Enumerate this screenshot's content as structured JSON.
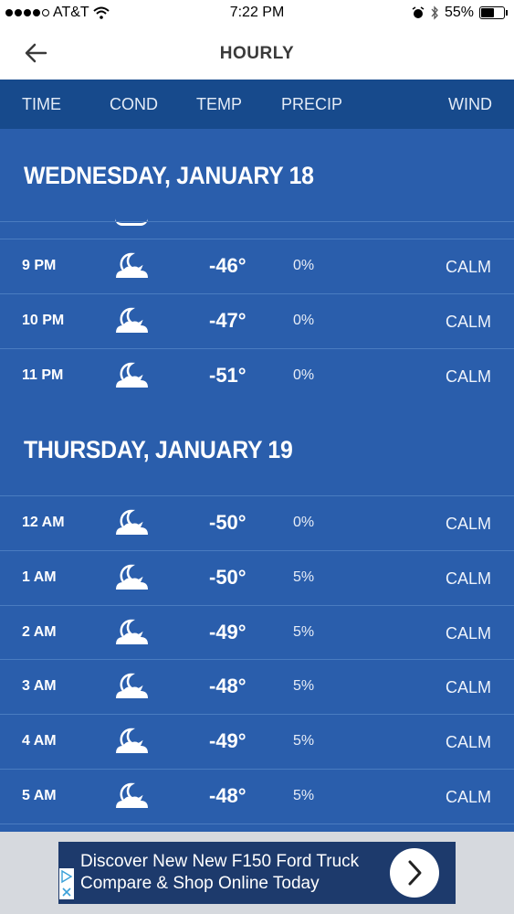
{
  "status_bar": {
    "carrier": "AT&T",
    "time": "7:22 PM",
    "battery": "55%"
  },
  "header": {
    "title": "HOURLY"
  },
  "columns": {
    "time": "TIME",
    "cond": "COND",
    "temp": "TEMP",
    "precip": "PRECIP",
    "wind": "WIND"
  },
  "days": [
    {
      "label": "WEDNESDAY, JANUARY 18",
      "rows": [
        {
          "time": "9 PM",
          "temp": "-46°",
          "precip": "0%",
          "wind": "CALM"
        },
        {
          "time": "10 PM",
          "temp": "-47°",
          "precip": "0%",
          "wind": "CALM"
        },
        {
          "time": "11 PM",
          "temp": "-51°",
          "precip": "0%",
          "wind": "CALM"
        }
      ]
    },
    {
      "label": "THURSDAY, JANUARY 19",
      "rows": [
        {
          "time": "12 AM",
          "temp": "-50°",
          "precip": "0%",
          "wind": "CALM"
        },
        {
          "time": "1 AM",
          "temp": "-50°",
          "precip": "5%",
          "wind": "CALM"
        },
        {
          "time": "2 AM",
          "temp": "-49°",
          "precip": "5%",
          "wind": "CALM"
        },
        {
          "time": "3 AM",
          "temp": "-48°",
          "precip": "5%",
          "wind": "CALM"
        },
        {
          "time": "4 AM",
          "temp": "-49°",
          "precip": "5%",
          "wind": "CALM"
        },
        {
          "time": "5 AM",
          "temp": "-48°",
          "precip": "5%",
          "wind": "CALM"
        }
      ]
    }
  ],
  "condition_icon": "partly-cloudy-night-icon",
  "ad": {
    "line1": "Discover New New F150 Ford Truck",
    "line2": "Compare & Shop Online Today"
  },
  "colors": {
    "header_bar": "#174a8c",
    "background": "#2a5eac",
    "ad_background": "#1d3a6c"
  }
}
